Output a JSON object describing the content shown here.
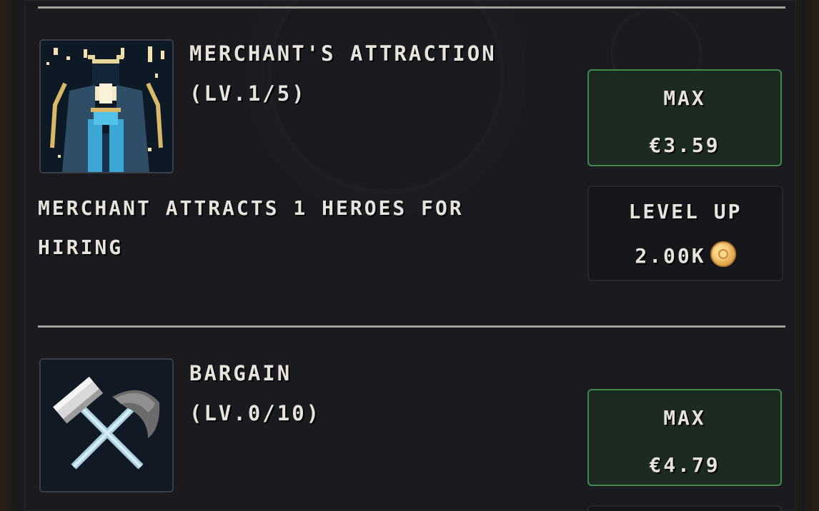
{
  "upgrades": [
    {
      "title": "MERCHANT'S ATTRACTION",
      "level": "(LV.1/5)",
      "description": "MERCHANT ATTRACTS 1 HEROES FOR HIRING",
      "icon": "merchant-silhouette-icon",
      "max_button": {
        "label": "MAX",
        "price": "€3.59"
      },
      "level_up_button": {
        "label": "LEVEL UP",
        "cost": "2.00K",
        "currency_icon": "gold-coin-icon"
      }
    },
    {
      "title": "BARGAIN",
      "level": "(LV.0/10)",
      "icon": "crossed-hammer-pickaxe-icon",
      "max_button": {
        "label": "MAX",
        "price": "€4.79"
      }
    }
  ],
  "colors": {
    "panel_bg": "#1b1b1f",
    "max_border": "#3e8a4b",
    "text": "#e6e3dc",
    "coin": "#e9b25a"
  }
}
